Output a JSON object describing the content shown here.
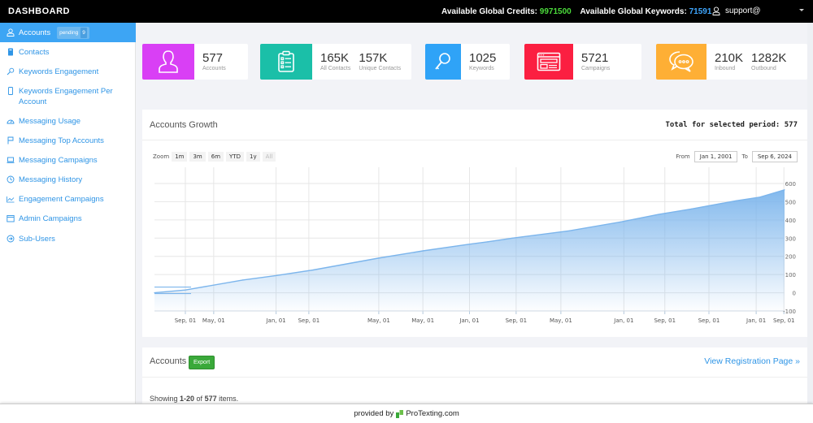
{
  "topbar": {
    "brand": "DASHBOARD",
    "credits_label": "Available Global Credits:",
    "credits_value": "9971500",
    "keywords_label": "Available Global Keywords:",
    "keywords_value": "71591",
    "user": "support@",
    "user_icon": "user-icon"
  },
  "sidebar": {
    "items": [
      {
        "label": "Accounts",
        "icon": "user-icon",
        "badge": "pending",
        "badge_count": "9",
        "active": true
      },
      {
        "label": "Contacts",
        "icon": "address-book-icon"
      },
      {
        "label": "Keywords Engagement",
        "icon": "key-icon"
      },
      {
        "label": "Keywords Engagement Per Account",
        "icon": "mobile-icon"
      },
      {
        "label": "Messaging Usage",
        "icon": "dashboard-icon"
      },
      {
        "label": "Messaging Top Accounts",
        "icon": "flag-icon"
      },
      {
        "label": "Messaging Campaigns",
        "icon": "laptop-icon"
      },
      {
        "label": "Messaging History",
        "icon": "clock-icon"
      },
      {
        "label": "Engagement Campaigns",
        "icon": "line-chart-icon"
      },
      {
        "label": "Admin Campaigns",
        "icon": "calendar-icon"
      },
      {
        "label": "Sub-Users",
        "icon": "arrow-circle-icon"
      }
    ]
  },
  "stats": [
    {
      "icon": "user-icon",
      "color": "#d93ff5",
      "values": [
        {
          "value": "577",
          "label": "Accounts"
        }
      ]
    },
    {
      "icon": "clipboard-icon",
      "color": "#1bbfa8",
      "values": [
        {
          "value": "165K",
          "label": "All Contacts"
        },
        {
          "value": "157K",
          "label": "Unique Contacts"
        }
      ]
    },
    {
      "icon": "key-icon",
      "color": "#2fa3f7",
      "values": [
        {
          "value": "1025",
          "label": "Keywords"
        }
      ]
    },
    {
      "icon": "browser-window-icon",
      "color": "#fb1f41",
      "values": [
        {
          "value": "5721",
          "label": "Campaigns"
        }
      ]
    },
    {
      "icon": "chat-bubbles-icon",
      "color": "#feaf35",
      "values": [
        {
          "value": "210K",
          "label": "Inbound"
        },
        {
          "value": "1282K",
          "label": "Outbound"
        }
      ]
    }
  ],
  "growth": {
    "title": "Accounts Growth",
    "total": "Total for selected period: 577",
    "zoom_label": "Zoom",
    "zoom_buttons": [
      "1m",
      "3m",
      "6m",
      "YTD",
      "1y",
      "All"
    ],
    "from_label": "From",
    "from_value": "Jan 1, 2001",
    "to_label": "To",
    "to_value": "Sep 6, 2024"
  },
  "chart_data": {
    "type": "area",
    "title": "Accounts Growth",
    "xlabel": "",
    "ylabel": "",
    "ylim": [
      -100,
      600
    ],
    "yticks": [
      600,
      500,
      400,
      300,
      200,
      100,
      0,
      -100
    ],
    "grid": true,
    "legend": "none",
    "x_tick_labels": [
      "Sep, 01",
      "May, 01",
      "Jan, 01",
      "Sep, 01",
      "May, 01",
      "May, 01",
      "Jan, 01",
      "Sep, 01",
      "May, 01",
      "Jan, 01",
      "Sep, 01",
      "Sep, 01",
      "Jan, 01",
      "Sep, 01"
    ],
    "x_tick_positions": [
      0.049,
      0.094,
      0.193,
      0.245,
      0.356,
      0.426,
      0.5,
      0.574,
      0.645,
      0.745,
      0.81,
      0.88,
      0.955,
      0.999
    ],
    "series": [
      {
        "name": "Accounts",
        "x": [
          0.0,
          0.049,
          0.14,
          0.194,
          0.252,
          0.355,
          0.426,
          0.497,
          0.529,
          0.568,
          0.658,
          0.742,
          0.8,
          0.852,
          0.923,
          0.961,
          1.0
        ],
        "values": [
          0,
          15,
          70,
          95,
          125,
          190,
          230,
          265,
          280,
          300,
          340,
          390,
          430,
          460,
          505,
          525,
          565
        ]
      }
    ],
    "color": "#7cb5ec"
  },
  "accounts": {
    "title": "Accounts",
    "export_label": "Export",
    "view_link": "View Registration Page »",
    "showing_prefix": "Showing ",
    "showing_range": "1-20",
    "showing_of": " of ",
    "showing_total": "577",
    "showing_suffix": " items."
  },
  "footer": {
    "text": "provided by",
    "brand": "ProTexting.com"
  }
}
